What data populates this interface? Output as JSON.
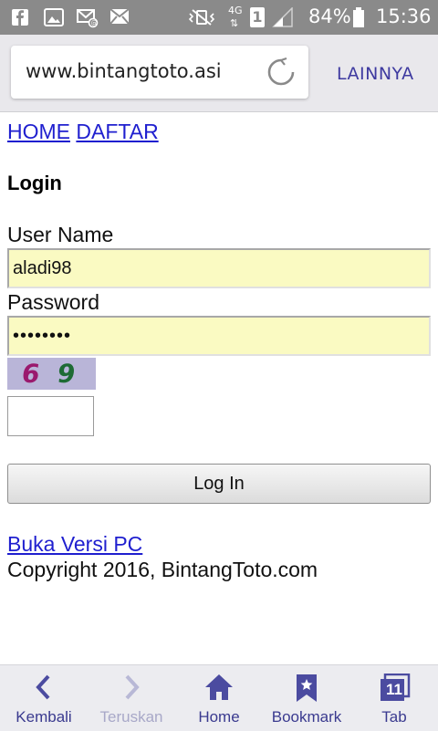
{
  "status_bar": {
    "battery_percent": "84%",
    "time": "15:36",
    "network_type": "4G",
    "sim_slot": "1",
    "icons": [
      "facebook-icon",
      "gallery-icon",
      "email-icon",
      "mail-icon",
      "vibrate-mute-icon",
      "signal-icon",
      "battery-icon"
    ]
  },
  "browser": {
    "url": "www.bintangtoto.asi",
    "more_label": "LAINNYA"
  },
  "page": {
    "nav_links": [
      "HOME",
      "DAFTAR"
    ],
    "login_title": "Login",
    "username_label": "User Name",
    "username_value": "aladi98",
    "password_label": "Password",
    "password_value": "••••••••",
    "captcha_digits": [
      "6",
      "9"
    ],
    "captcha_input_value": "",
    "login_button": "Log In",
    "pc_version_link": "Buka Versi PC",
    "copyright": "Copyright 2016, BintangToto.com"
  },
  "bottom_nav": {
    "back": "Kembali",
    "forward": "Teruskan",
    "home": "Home",
    "bookmark": "Bookmark",
    "tab": "Tab",
    "tab_count": "11"
  },
  "colors": {
    "link": "#1f1fcf",
    "input_bg": "#fafac2",
    "nav_accent": "#4b4ba0"
  }
}
